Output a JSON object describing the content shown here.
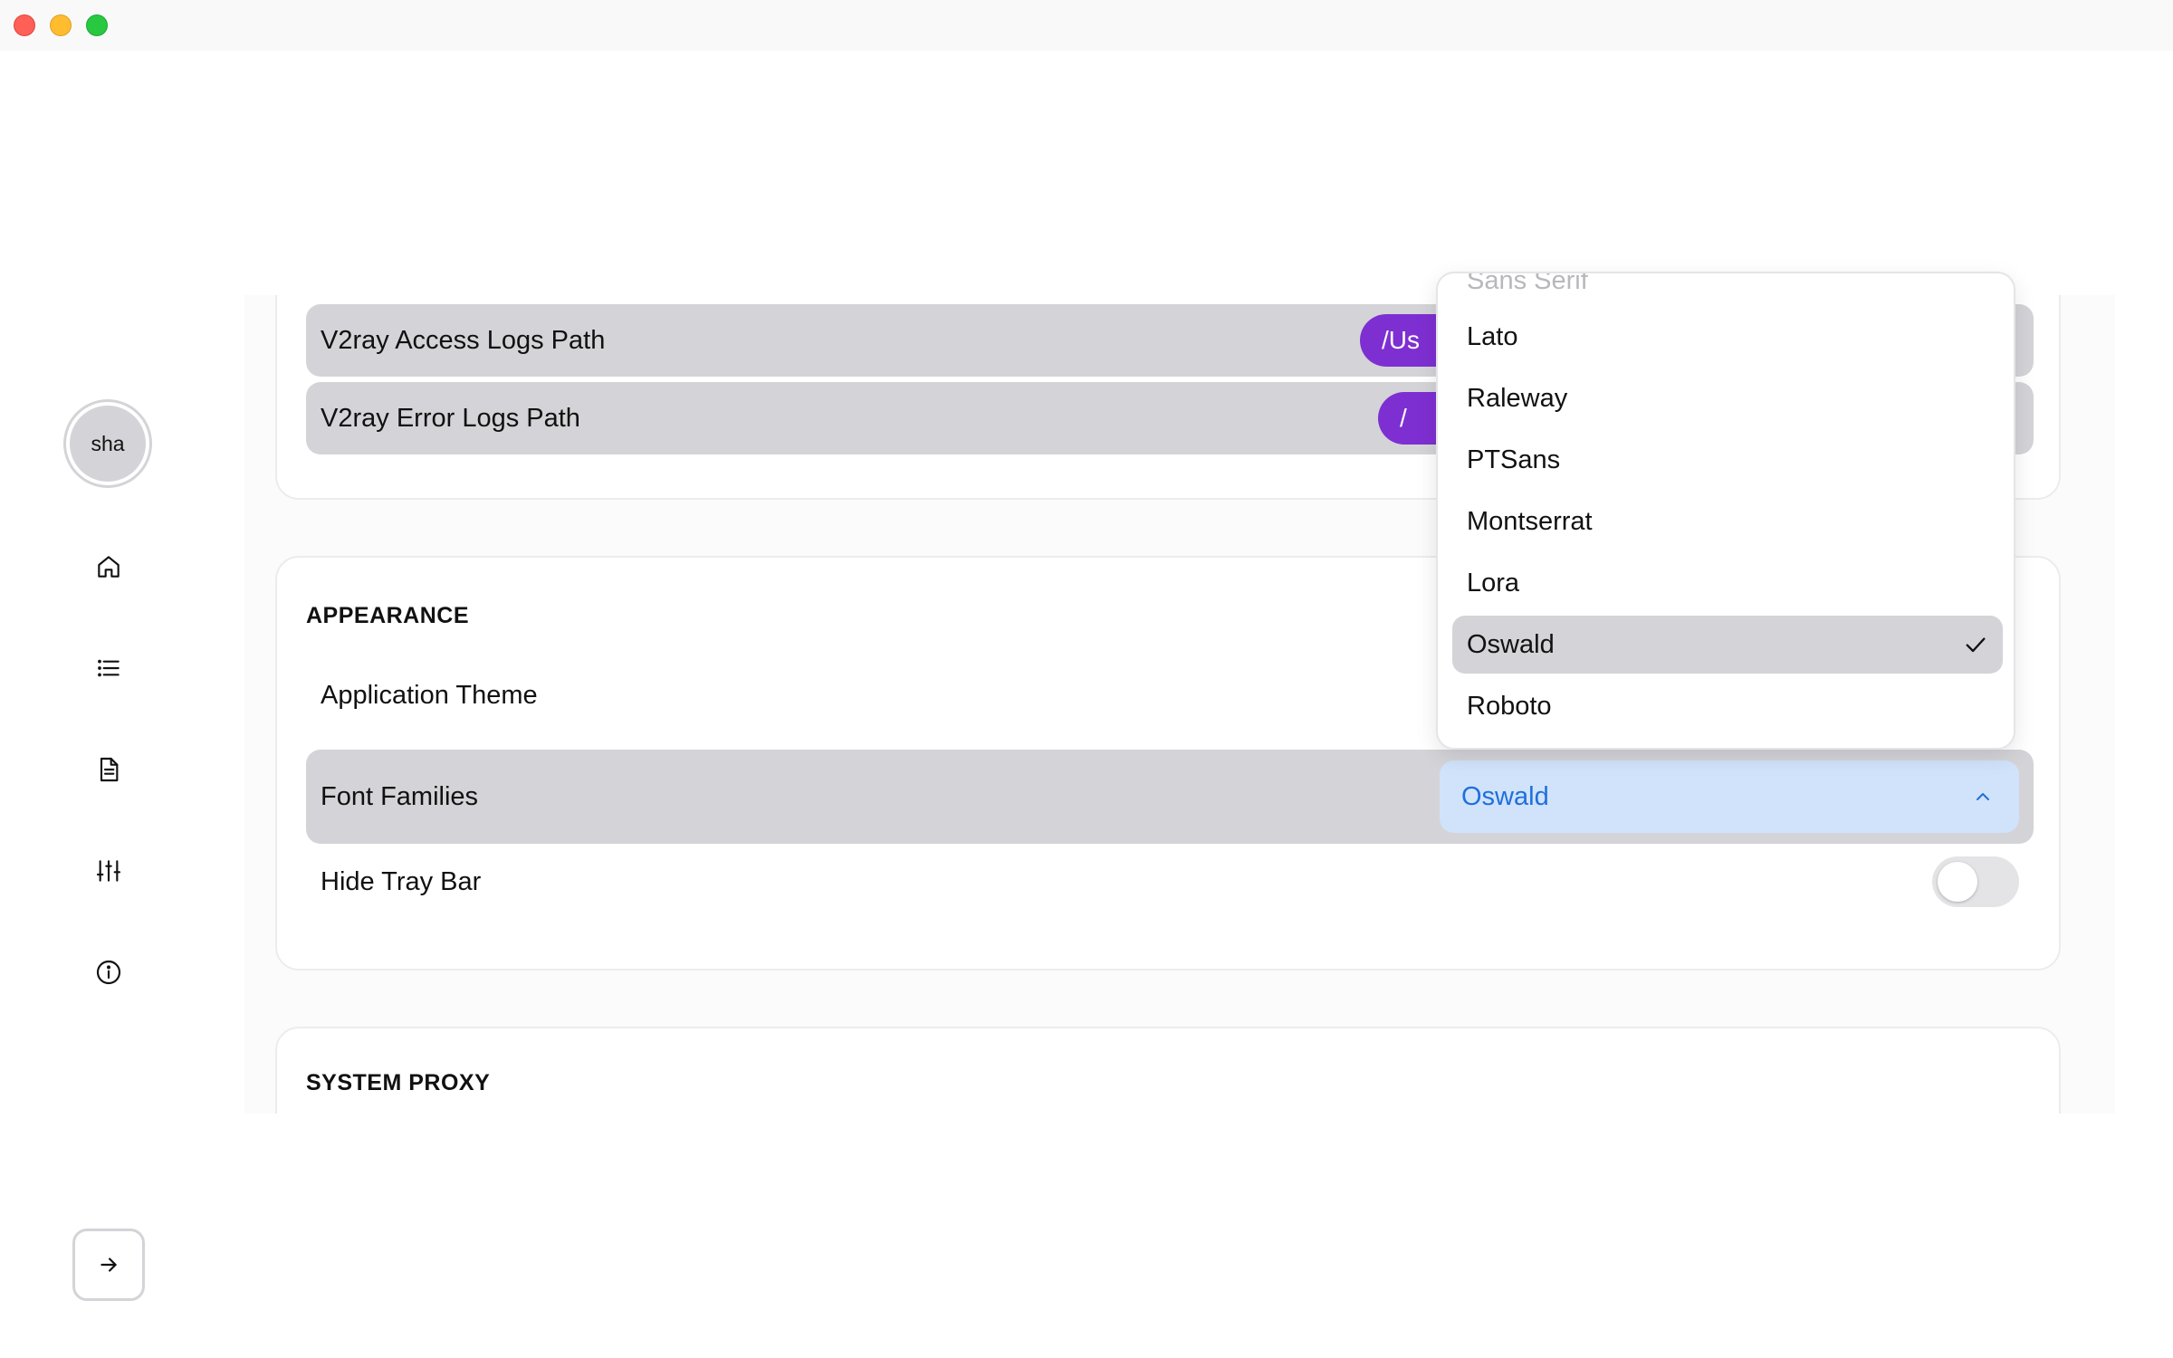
{
  "sidebar": {
    "avatar_text": "sha",
    "nav": [
      {
        "name": "home",
        "icon": "home-icon"
      },
      {
        "name": "list",
        "icon": "list-icon"
      },
      {
        "name": "logs",
        "icon": "document-icon"
      },
      {
        "name": "settings",
        "icon": "sliders-icon"
      },
      {
        "name": "about",
        "icon": "info-icon"
      }
    ],
    "collapse_icon": "arrow-right-icon"
  },
  "logs_section": {
    "access_logs_label": "V2ray Access Logs Path",
    "access_logs_value": "/Us",
    "error_logs_label": "V2ray Error Logs Path",
    "error_logs_value": "/"
  },
  "appearance": {
    "title": "APPEARANCE",
    "theme_label": "Application Theme",
    "font_label": "Font Families",
    "font_value": "Oswald",
    "tray_label": "Hide Tray Bar",
    "tray_enabled": false
  },
  "system_proxy": {
    "title": "SYSTEM PROXY"
  },
  "font_dropdown": {
    "partial_top_option": "Sans Serif",
    "options": [
      "Lato",
      "Raleway",
      "PTSans",
      "Montserrat",
      "Lora",
      "Oswald",
      "Roboto"
    ],
    "selected": "Oswald"
  },
  "colors": {
    "accent_purple": "#7e2fd1",
    "select_bg": "#d0e3fb",
    "select_text": "#1f6fdc",
    "row_shade": "#d4d4d8"
  }
}
